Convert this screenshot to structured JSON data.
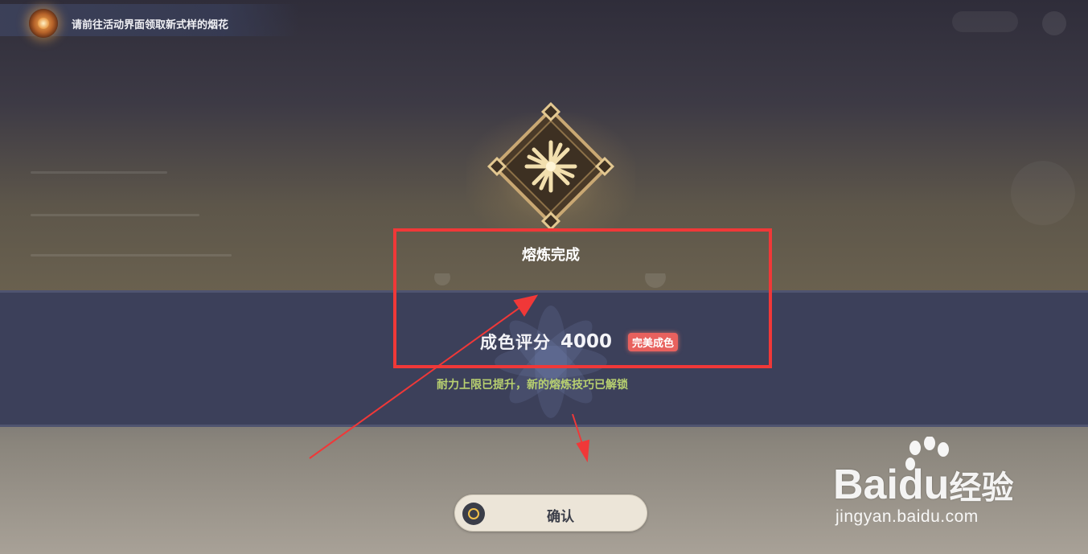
{
  "notification": {
    "text": "请前往活动界面领取新式样的烟花",
    "icon": "firework-icon"
  },
  "result": {
    "title": "熔炼完成",
    "score_label": "成色评分",
    "score_value": "4000",
    "badge": "完美成色",
    "subtext": "耐力上限已提升，新的熔炼技巧已解锁"
  },
  "confirm": {
    "label": "确认"
  },
  "watermark": {
    "brand_latin": "Bai",
    "brand_du": "du",
    "brand_cn": "经验",
    "url": "jingyan.baidu.com"
  },
  "colors": {
    "annotation_red": "#f03838",
    "badge_red": "#e8615e",
    "subtext_green": "#b8d070",
    "banner_navy": "#3c405a",
    "button_cream": "#ece5d8"
  }
}
